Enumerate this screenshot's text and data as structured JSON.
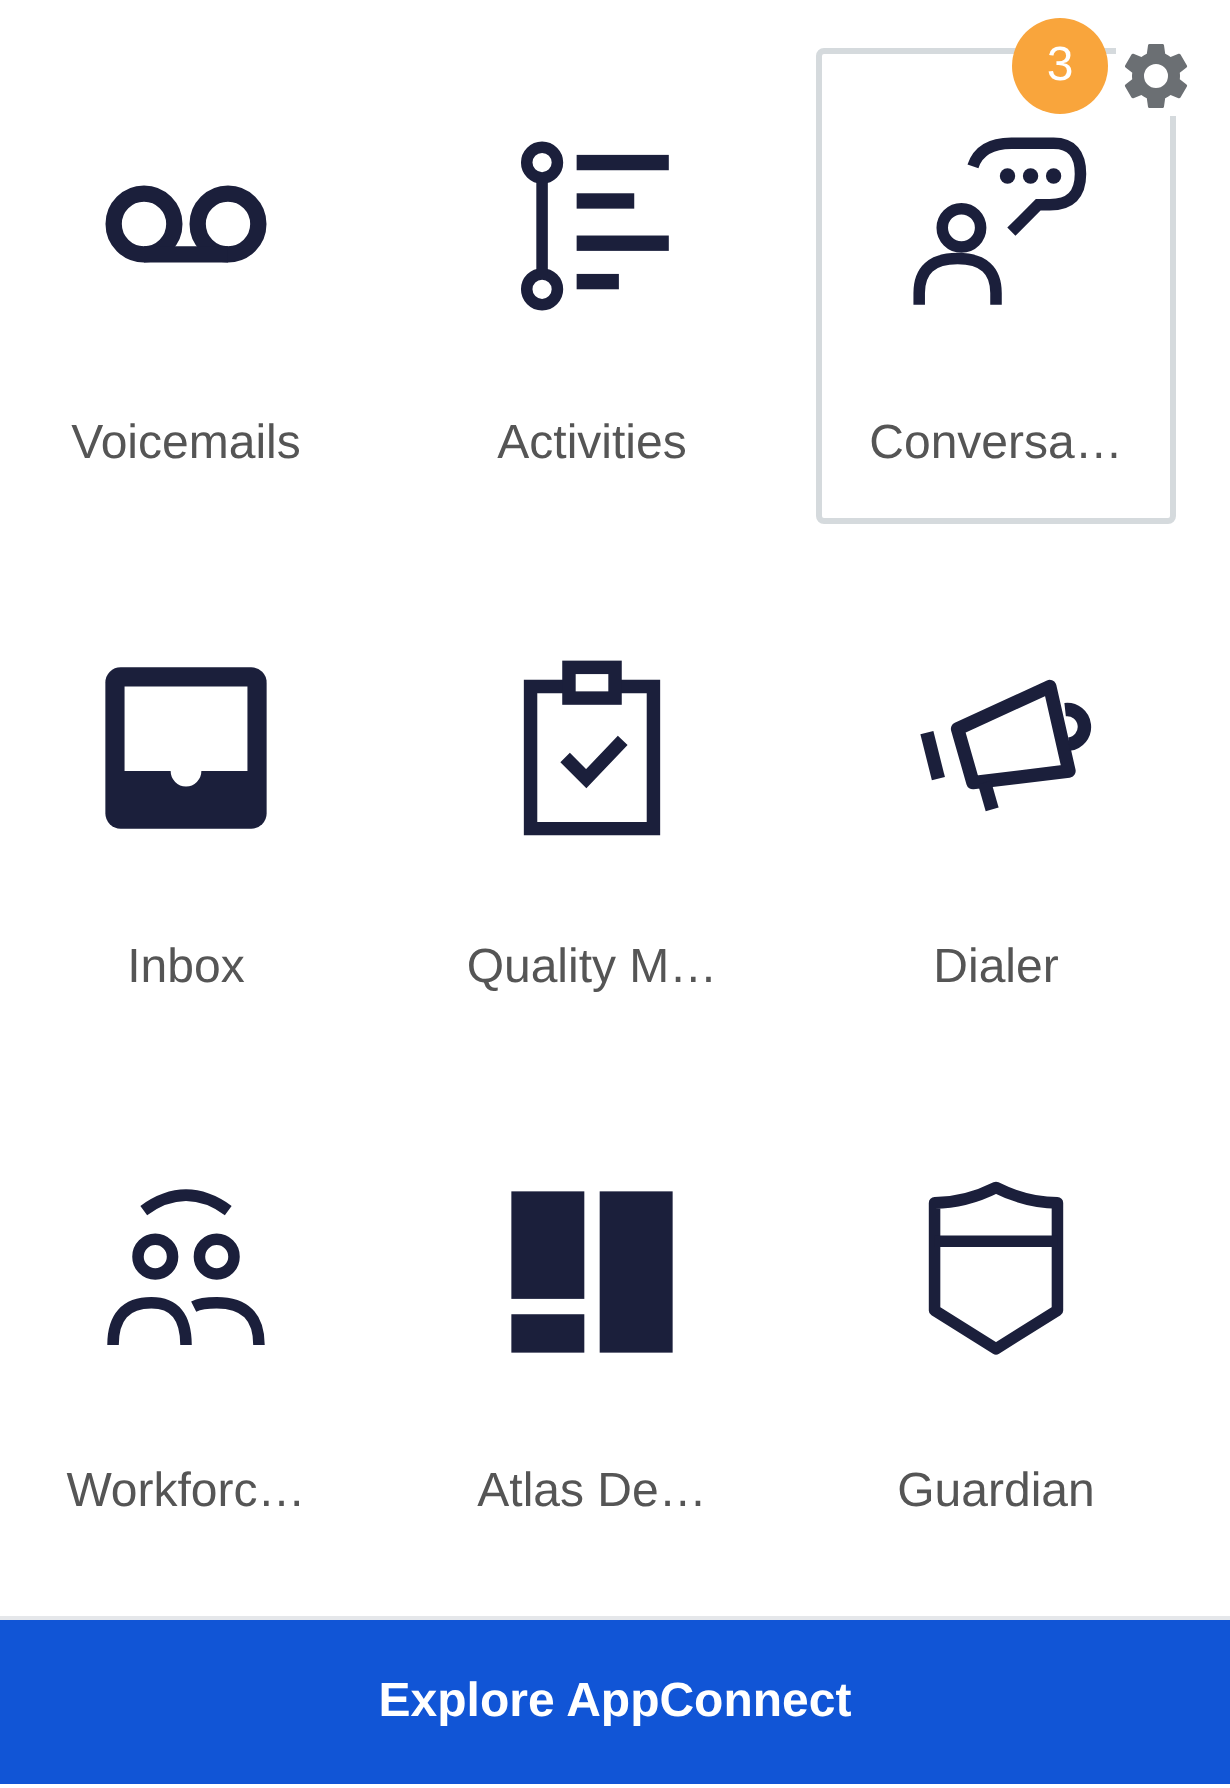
{
  "apps": [
    {
      "label": "Voicemails",
      "kind": "voicemail",
      "selected": false
    },
    {
      "label": "Activities",
      "kind": "activities",
      "selected": false
    },
    {
      "label": "Conversa…",
      "kind": "conversations",
      "selected": true
    },
    {
      "label": "Inbox",
      "kind": "inbox",
      "selected": false
    },
    {
      "label": "Quality M…",
      "kind": "quality",
      "selected": false
    },
    {
      "label": "Dialer",
      "kind": "dialer",
      "selected": false
    },
    {
      "label": "Workforc…",
      "kind": "workforce",
      "selected": false
    },
    {
      "label": "Atlas De…",
      "kind": "atlas",
      "selected": false
    },
    {
      "label": "Guardian",
      "kind": "guardian",
      "selected": false
    }
  ],
  "tile_settings": {
    "badge": "3"
  },
  "footer_button": "Explore AppConnect"
}
